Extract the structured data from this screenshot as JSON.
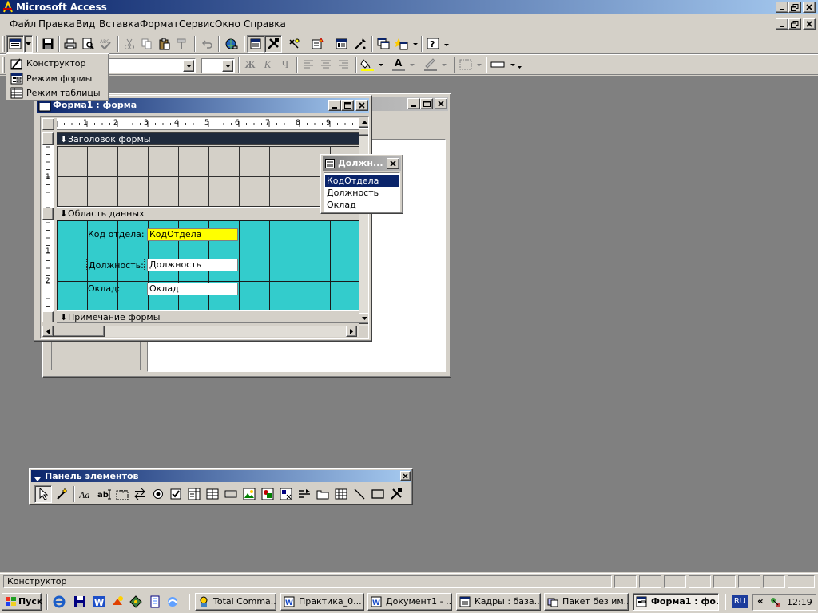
{
  "app": {
    "title": "Microsoft Access",
    "colors": {
      "titlebar": "#0a246a",
      "titlebar_end": "#a6caf0",
      "desktop": "#808080",
      "detail_section": "#33cccc",
      "highlight_field": "#ffff00"
    }
  },
  "menu": {
    "items": [
      "Файл",
      "Правка",
      "Вид",
      "Вставка",
      "Формат",
      "Сервис",
      "Окно",
      "Справка"
    ]
  },
  "format_toolbar": {
    "bold": "Ж",
    "italic": "К",
    "underline": "Ч"
  },
  "view_dropdown": {
    "items": [
      "Конструктор",
      "Режим формы",
      "Режим таблицы"
    ]
  },
  "form_window": {
    "title": "Форма1 : форма",
    "ruler_numbers": [
      "1",
      "2",
      "3",
      "4",
      "5",
      "6",
      "7",
      "8",
      "9"
    ],
    "vruler_numbers": [
      "1",
      "1",
      "2"
    ],
    "sections": {
      "header": "Заголовок формы",
      "detail": "Область данных",
      "footer": "Примечание формы"
    },
    "fields": [
      {
        "label": "Код отдела:",
        "value": "КодОтдела"
      },
      {
        "label": "Должность:",
        "value": "Должность"
      },
      {
        "label": "Оклад:",
        "value": "Оклад"
      }
    ]
  },
  "field_list": {
    "title": "Должн...",
    "items": [
      "КодОтдела",
      "Должность",
      "Оклад"
    ],
    "selected_index": 0
  },
  "toolbox": {
    "title": "Панель элементов",
    "icons": [
      "pointer-icon",
      "wizard-icon",
      "label-icon",
      "textbox-icon",
      "option-group-icon",
      "toggle-button-icon",
      "option-button-icon",
      "checkbox-icon",
      "combobox-icon",
      "listbox-icon",
      "command-button-icon",
      "image-icon",
      "unbound-frame-icon",
      "bound-frame-icon",
      "page-break-icon",
      "tab-control-icon",
      "subform-icon",
      "line-icon",
      "rectangle-icon",
      "more-controls-icon"
    ]
  },
  "status_bar": {
    "text": "Конструктор"
  },
  "taskbar": {
    "start_label": "Пуск",
    "tasks": [
      "Total Comma...",
      "Практика_0...",
      "Документ1 - ...",
      "Кадры : база...",
      "Пакет без им...",
      "Форма1 : фо..."
    ],
    "active_index": 5,
    "lang": "RU",
    "expand": "«",
    "clock": "12:19"
  }
}
